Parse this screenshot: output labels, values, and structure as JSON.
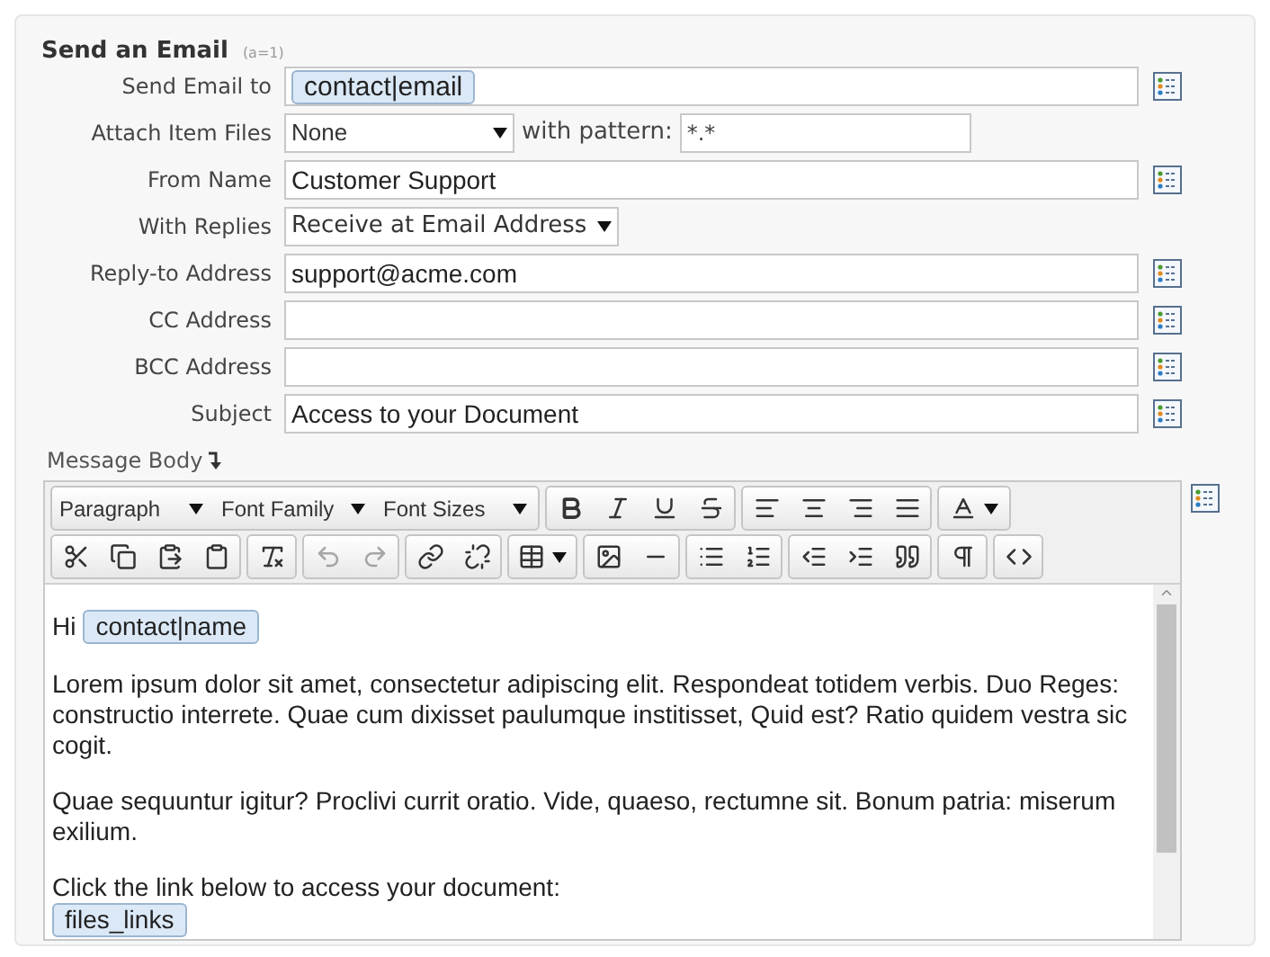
{
  "section": {
    "title": "Send an Email",
    "note": "(a=1)"
  },
  "fields": [
    {
      "kind": "token",
      "label": "Send Email to",
      "token": "contact|email"
    },
    {
      "kind": "select_pattern",
      "label": "Attach Item Files",
      "value": "None",
      "pattern_label": "with pattern:",
      "pattern": "*.*"
    },
    {
      "kind": "text",
      "label": "From Name",
      "value": "Customer Support"
    },
    {
      "kind": "select",
      "label": "With Replies",
      "value": "Receive at Email Address"
    },
    {
      "kind": "text",
      "label": "Reply-to Address",
      "value": "support@acme.com"
    },
    {
      "kind": "text",
      "label": "CC Address"
    },
    {
      "kind": "text",
      "label": "BCC Address"
    },
    {
      "kind": "text",
      "label": "Subject",
      "value": "Access to your Document"
    }
  ],
  "message_body": {
    "label": "Message Body",
    "dropdowns": [
      "Paragraph",
      "Font Family",
      "Font Sizes"
    ],
    "content": [
      {
        "kind": "greeting",
        "text": "Hi",
        "token": "contact|name"
      },
      {
        "kind": "paragraph",
        "text": "Lorem ipsum dolor sit amet, consectetur adipiscing elit. Respondeat totidem verbis. Duo Reges: constructio interrete. Quae cum dixisset paulumque institisset, Quid est? Ratio quidem vestra sic cogit."
      },
      {
        "kind": "paragraph",
        "text": "Quae sequuntur igitur? Proclivi currit oratio. Vide, quaeso, rectumne sit. Bonum patria: miserum exilium."
      },
      {
        "kind": "link_block",
        "text": "Click the link below to access your document:",
        "token": "files_links"
      }
    ]
  }
}
